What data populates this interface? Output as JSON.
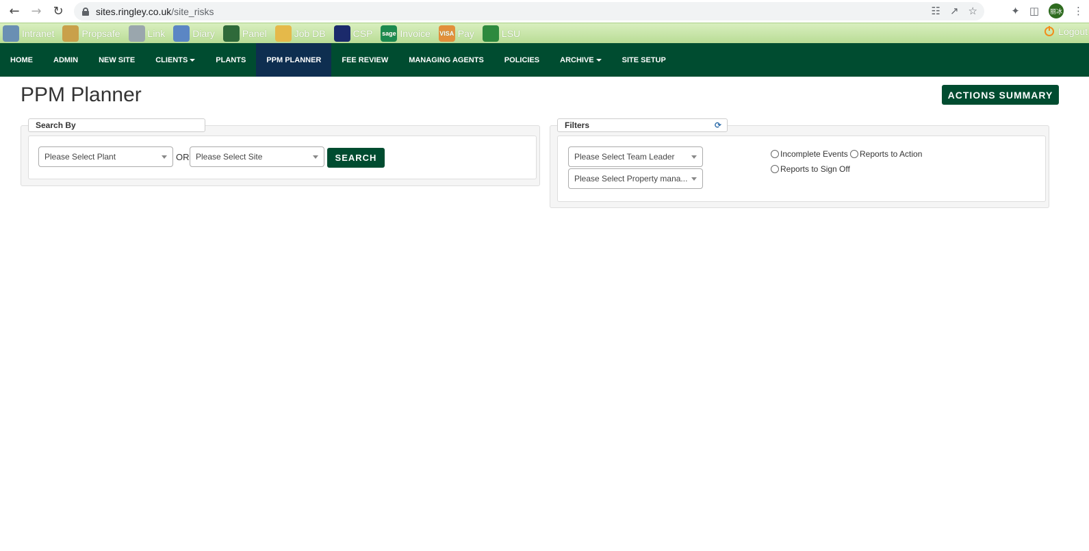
{
  "browser": {
    "url_host": "sites.ringley.co.uk",
    "url_path": "/site_risks",
    "profile_initials": "丽冰"
  },
  "quick_links": [
    {
      "label": "Intranet",
      "icon": "globe-icon",
      "color": "#6a8fb3"
    },
    {
      "label": "Propsafe",
      "icon": "propsafe-icon",
      "color": "#c9a04a"
    },
    {
      "label": "Link",
      "icon": "chain-link-icon",
      "color": "#9aa6ad"
    },
    {
      "label": "Diary",
      "icon": "calendar-icon",
      "color": "#5b86c4"
    },
    {
      "label": "Panel",
      "icon": "panel-icon",
      "color": "#2f6a3a"
    },
    {
      "label": "Job DB",
      "icon": "folder-icon",
      "color": "#e5b94a"
    },
    {
      "label": "CSP",
      "icon": "csp-icon",
      "color": "#1b2a6b"
    },
    {
      "label": "Invoice",
      "icon": "sage-icon",
      "color": "#1d8a4f",
      "icon_text": "sage"
    },
    {
      "label": "Pay",
      "icon": "card-icon",
      "color": "#e28f3b",
      "icon_text": "VISA"
    },
    {
      "label": "LSU",
      "icon": "house-icon",
      "color": "#2e8a3e"
    }
  ],
  "logout_label": "Logout",
  "nav": [
    {
      "label": "HOME",
      "dropdown": false,
      "active": false
    },
    {
      "label": "ADMIN",
      "dropdown": false,
      "active": false
    },
    {
      "label": "NEW SITE",
      "dropdown": false,
      "active": false
    },
    {
      "label": "CLIENTS",
      "dropdown": true,
      "active": false
    },
    {
      "label": "PLANTS",
      "dropdown": false,
      "active": false
    },
    {
      "label": "PPM PLANNER",
      "dropdown": false,
      "active": true
    },
    {
      "label": "FEE REVIEW",
      "dropdown": false,
      "active": false
    },
    {
      "label": "MANAGING AGENTS",
      "dropdown": false,
      "active": false
    },
    {
      "label": "POLICIES",
      "dropdown": false,
      "active": false
    },
    {
      "label": "ARCHIVE",
      "dropdown": true,
      "active": false
    },
    {
      "label": "SITE SETUP",
      "dropdown": false,
      "active": false
    }
  ],
  "page": {
    "title": "PPM Planner",
    "actions_summary": "ACTIONS SUMMARY"
  },
  "search_panel": {
    "legend": "Search By",
    "plant_placeholder": "Please Select Plant",
    "or_label": "OR",
    "site_placeholder": "Please Select Site",
    "search_label": "SEARCH"
  },
  "filters_panel": {
    "legend": "Filters",
    "team_leader_placeholder": "Please Select Team Leader",
    "property_manager_placeholder": "Please Select Property mana...",
    "radios": [
      "Incomplete Events",
      "Reports to Action",
      "Reports to Sign Off"
    ]
  },
  "colors": {
    "nav_bg": "#004c30",
    "nav_active": "#0e2e50",
    "button_bg": "#004c30",
    "quick_bar": "#b9dc96"
  }
}
